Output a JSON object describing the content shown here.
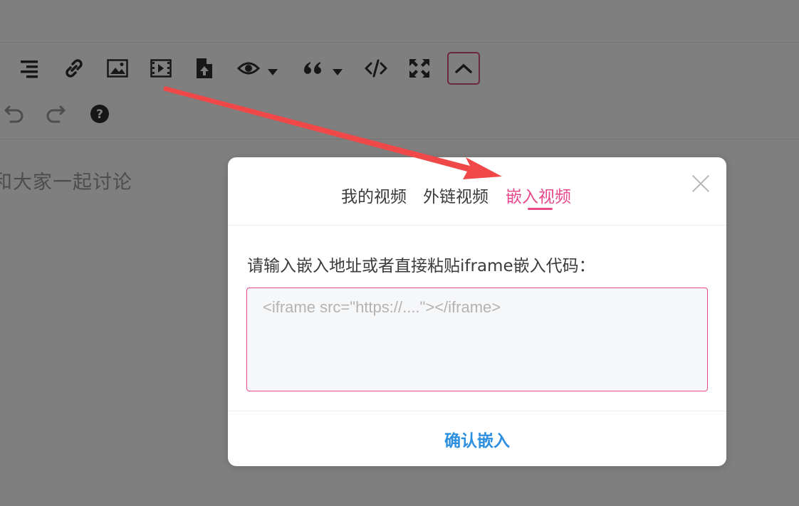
{
  "editor": {
    "placeholder": "和大家一起讨论",
    "toolbar_row1": [
      {
        "icon": "align-right-icon"
      },
      {
        "icon": "link-icon"
      },
      {
        "icon": "image-icon"
      },
      {
        "icon": "video-icon"
      },
      {
        "icon": "file-upload-icon"
      },
      {
        "icon": "eye-icon",
        "has_dropdown": true
      },
      {
        "icon": "quote-icon",
        "has_dropdown": true
      },
      {
        "icon": "code-icon"
      },
      {
        "icon": "fullscreen-icon"
      },
      {
        "icon": "chevron-up-icon",
        "active": true
      }
    ],
    "toolbar_row2": [
      {
        "icon": "undo-icon"
      },
      {
        "icon": "redo-icon"
      },
      {
        "icon": "help-icon"
      }
    ]
  },
  "modal": {
    "tabs": [
      {
        "label": "我的视频"
      },
      {
        "label": "外链视频"
      },
      {
        "label": "嵌入视频",
        "active": true
      }
    ],
    "prompt": "请输入嵌入地址或者直接粘贴iframe嵌入代码：",
    "input": {
      "value": "",
      "placeholder": "<iframe src=\"https://....\"></iframe>"
    },
    "confirm_label": "确认嵌入"
  },
  "colors": {
    "accent_pink": "#e8488c",
    "confirm_blue": "#2d8fe0",
    "annotation_arrow": "#f04848"
  }
}
